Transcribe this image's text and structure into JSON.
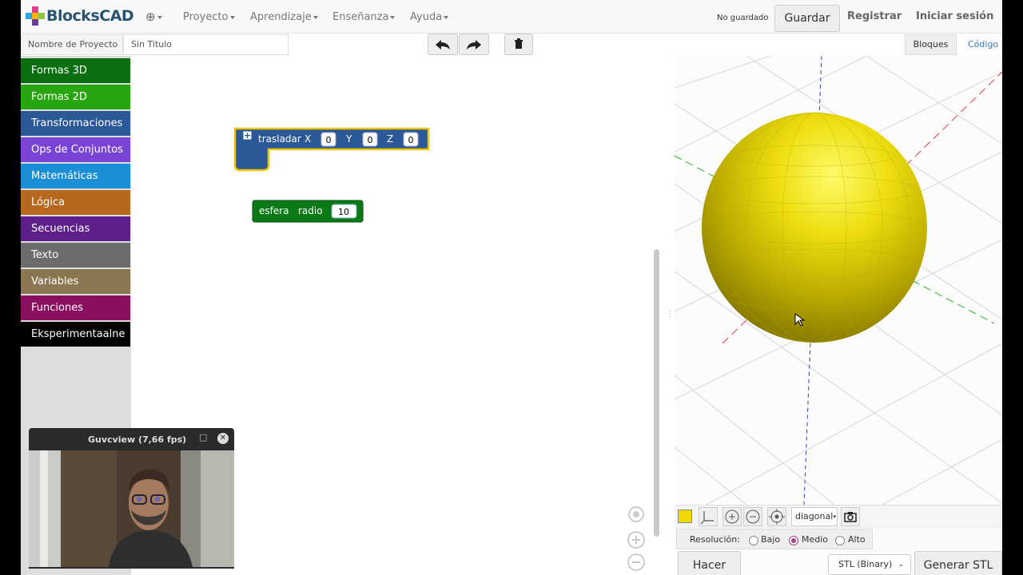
{
  "navbar": {
    "brand": "BlocksCAD",
    "menus": [
      "Proyecto",
      "Aprendizaje",
      "Enseñanza",
      "Ayuda"
    ],
    "status": "No guardado",
    "save": "Guardar",
    "register": "Registrar",
    "login": "Iniciar sesión"
  },
  "project": {
    "label": "Nombre de Proyecto",
    "value": "Sin Titulo"
  },
  "tabs": {
    "blocks": "Bloques",
    "code": "Código"
  },
  "toolbox": [
    {
      "label": "Formas 3D",
      "color": "#0b6e10"
    },
    {
      "label": "Formas 2D",
      "color": "#2aa512"
    },
    {
      "label": "Transformaciones",
      "color": "#2b5896"
    },
    {
      "label": "Ops de Conjuntos",
      "color": "#7a45d6"
    },
    {
      "label": "Matemáticas",
      "color": "#1a8ed6"
    },
    {
      "label": "Lógica",
      "color": "#b6681f"
    },
    {
      "label": "Secuencias",
      "color": "#5e1f8a"
    },
    {
      "label": "Texto",
      "color": "#6c6c6c"
    },
    {
      "label": "Variables",
      "color": "#8a7650"
    },
    {
      "label": "Funciones",
      "color": "#8a0f5e"
    },
    {
      "label": "Eksperimentaalne",
      "color": "#000000"
    }
  ],
  "blocks": {
    "translate": {
      "title": "trasladar",
      "x_label": "X",
      "x": "0",
      "y_label": "Y",
      "y": "0",
      "z_label": "Z",
      "z": "0"
    },
    "sphere": {
      "title": "esfera",
      "radius_label": "radio",
      "radius": "10"
    }
  },
  "viewer": {
    "view_option": "diagonal",
    "resolution_label": "Resolución:",
    "resolutions": [
      "Bajo",
      "Medio",
      "Alto"
    ],
    "resolution_selected": "Medio",
    "object_color": "#f0d800",
    "render": "Hacer",
    "export_format": "STL (Binary)",
    "export": "Generar STL"
  },
  "webcam": {
    "title": "Guvcview  (7,66 fps)"
  }
}
